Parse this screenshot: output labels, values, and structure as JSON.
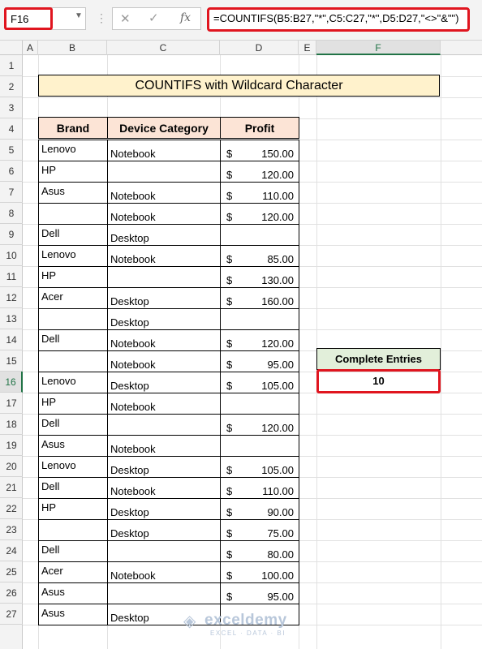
{
  "formula_bar": {
    "name_box": "F16",
    "cancel_glyph": "✕",
    "enter_glyph": "✓",
    "fx_label": "fx",
    "formula": "=COUNTIFS(B5:B27,\"*\",C5:C27,\"*\",D5:D27,\"<>\"&\"\")"
  },
  "columns": [
    "A",
    "B",
    "C",
    "D",
    "E",
    "F"
  ],
  "rows": [
    "1",
    "2",
    "3",
    "4",
    "5",
    "6",
    "7",
    "8",
    "9",
    "10",
    "11",
    "12",
    "13",
    "14",
    "15",
    "16",
    "17",
    "18",
    "19",
    "20",
    "21",
    "22",
    "23",
    "24",
    "25",
    "26",
    "27"
  ],
  "title": "COUNTIFS with Wildcard Character",
  "table": {
    "headers": [
      "Brand",
      "Device Category",
      "Profit"
    ],
    "currency_symbol": "$",
    "rows": [
      {
        "brand": "Lenovo",
        "category": "Notebook",
        "profit": "150.00"
      },
      {
        "brand": "HP",
        "category": "",
        "profit": "120.00"
      },
      {
        "brand": "Asus",
        "category": "Notebook",
        "profit": "110.00"
      },
      {
        "brand": "",
        "category": "Notebook",
        "profit": "120.00"
      },
      {
        "brand": "Dell",
        "category": "Desktop",
        "profit": ""
      },
      {
        "brand": "Lenovo",
        "category": "Notebook",
        "profit": "85.00"
      },
      {
        "brand": "HP",
        "category": "",
        "profit": "130.00"
      },
      {
        "brand": "Acer",
        "category": "Desktop",
        "profit": "160.00"
      },
      {
        "brand": "",
        "category": "Desktop",
        "profit": ""
      },
      {
        "brand": "Dell",
        "category": "Notebook",
        "profit": "120.00"
      },
      {
        "brand": "",
        "category": "Notebook",
        "profit": "95.00"
      },
      {
        "brand": "Lenovo",
        "category": "Desktop",
        "profit": "105.00"
      },
      {
        "brand": "HP",
        "category": "Notebook",
        "profit": ""
      },
      {
        "brand": "Dell",
        "category": "",
        "profit": "120.00"
      },
      {
        "brand": "Asus",
        "category": "Notebook",
        "profit": ""
      },
      {
        "brand": "Lenovo",
        "category": "Desktop",
        "profit": "105.00"
      },
      {
        "brand": "Dell",
        "category": "Notebook",
        "profit": "110.00"
      },
      {
        "brand": "HP",
        "category": "Desktop",
        "profit": "90.00"
      },
      {
        "brand": "",
        "category": "Desktop",
        "profit": "75.00"
      },
      {
        "brand": "Dell",
        "category": "",
        "profit": "80.00"
      },
      {
        "brand": "Acer",
        "category": "Notebook",
        "profit": "100.00"
      },
      {
        "brand": "Asus",
        "category": "",
        "profit": "95.00"
      },
      {
        "brand": "Asus",
        "category": "Desktop",
        "profit": ""
      }
    ]
  },
  "result": {
    "label": "Complete Entries",
    "value": "10"
  },
  "watermark": {
    "logo_glyph": "◈",
    "name": "exceldemy",
    "tagline": "EXCEL · DATA · BI"
  },
  "colors": {
    "selection_red": "#e0151f",
    "title_fill": "#fff2cc",
    "header_fill": "#fce4d6",
    "result_label_fill": "#e2efda",
    "excel_green": "#217346"
  }
}
